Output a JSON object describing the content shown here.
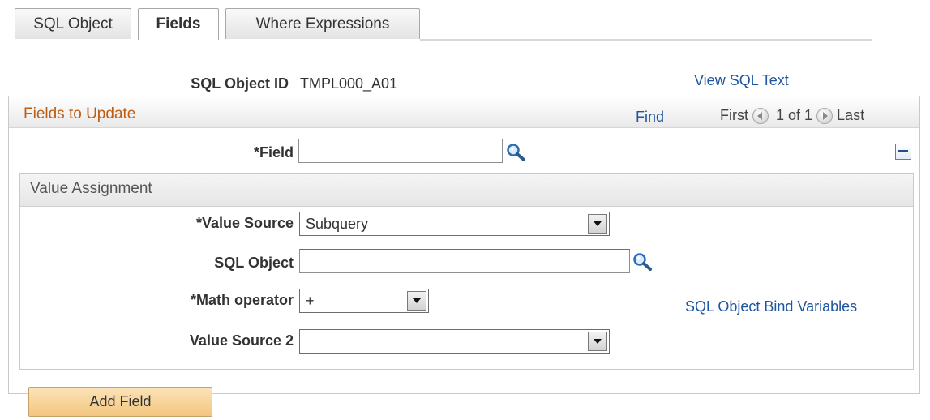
{
  "tabs": [
    {
      "label": "SQL Object",
      "active": false
    },
    {
      "label": "Fields",
      "active": true
    },
    {
      "label": "Where Expressions",
      "active": false
    }
  ],
  "header": {
    "sql_object_id_label": "SQL Object ID",
    "sql_object_id_value": "TMPL000_A01",
    "view_sql_text_link": "View SQL Text"
  },
  "grid": {
    "title": "Fields to Update",
    "find_link": "Find",
    "first_label": "First",
    "page_count": "1 of 1",
    "last_label": "Last",
    "field_label": "*Field",
    "field_value": "",
    "collapse_icon": "minus-icon"
  },
  "value_assignment": {
    "title": "Value Assignment",
    "value_source_label": "*Value Source",
    "value_source_value": "Subquery",
    "sql_object_label": "SQL Object",
    "sql_object_value": "",
    "math_operator_label": "*Math operator",
    "math_operator_value": "+",
    "bind_variables_link": "SQL Object Bind Variables",
    "value_source2_label": "Value Source 2",
    "value_source2_value": ""
  },
  "actions": {
    "add_field_label": "Add Field"
  },
  "colors": {
    "link": "#1f56a0",
    "grid_title": "#c05c10",
    "button_bg": "#f3c67f"
  }
}
